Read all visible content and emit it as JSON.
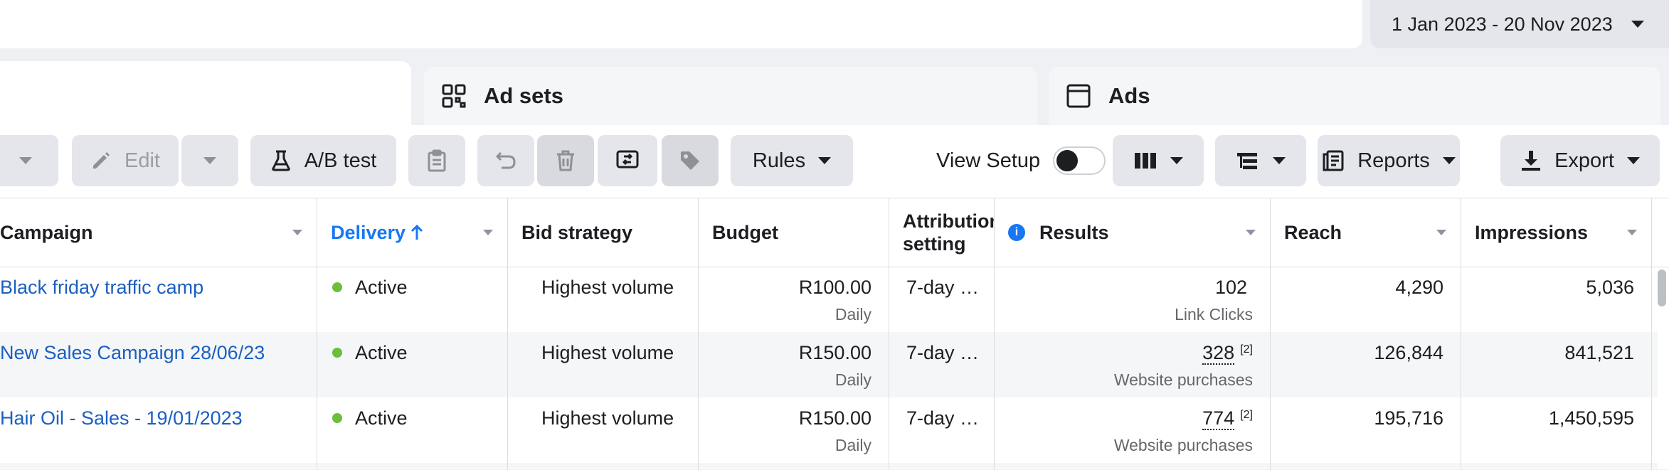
{
  "date_range": {
    "label": "1 Jan 2023 - 20 Nov 2023"
  },
  "tabs": {
    "ad_sets": "Ad sets",
    "ads": "Ads"
  },
  "toolbar": {
    "edit": "Edit",
    "ab_test": "A/B test",
    "rules": "Rules",
    "view_setup": "View Setup",
    "view_setup_enabled": false,
    "reports": "Reports",
    "export": "Export"
  },
  "columns": {
    "campaign": "Campaign",
    "delivery": "Delivery",
    "bid_strategy": "Bid strategy",
    "budget": "Budget",
    "attribution_line1": "Attribution",
    "attribution_line2": "setting",
    "results": "Results",
    "reach": "Reach",
    "impressions": "Impressions"
  },
  "rows": [
    {
      "campaign": "Black friday traffic camp",
      "delivery": "Active",
      "bid_strategy": "Highest volume",
      "budget": "R100.00",
      "budget_period": "Daily",
      "attribution": "7-day …",
      "results": "102",
      "results_note": "",
      "results_type": "Link Clicks",
      "reach": "4,290",
      "impressions": "5,036"
    },
    {
      "campaign": "New Sales Campaign 28/06/23",
      "delivery": "Active",
      "bid_strategy": "Highest volume",
      "budget": "R150.00",
      "budget_period": "Daily",
      "attribution": "7-day …",
      "results": "328",
      "results_note": "[2]",
      "results_type": "Website purchases",
      "reach": "126,844",
      "impressions": "841,521"
    },
    {
      "campaign": "Hair Oil - Sales - 19/01/2023",
      "delivery": "Active",
      "bid_strategy": "Highest volume",
      "budget": "R150.00",
      "budget_period": "Daily",
      "attribution": "7-day …",
      "results": "774",
      "results_note": "[2]",
      "results_type": "Website purchases",
      "reach": "195,716",
      "impressions": "1,450,595"
    }
  ],
  "colors": {
    "link": "#1a5fc2",
    "active": "#6bbf3b",
    "accent": "#1877f2"
  },
  "icons": [
    "chevron-down-icon",
    "pencil-icon",
    "flask-icon",
    "clipboard-icon",
    "undo-icon",
    "trash-icon",
    "swap-icon",
    "tag-icon",
    "columns-icon",
    "breakdown-icon",
    "reports-icon",
    "download-icon",
    "grid-icon",
    "ad-icon",
    "info-icon",
    "sort-up-icon"
  ]
}
